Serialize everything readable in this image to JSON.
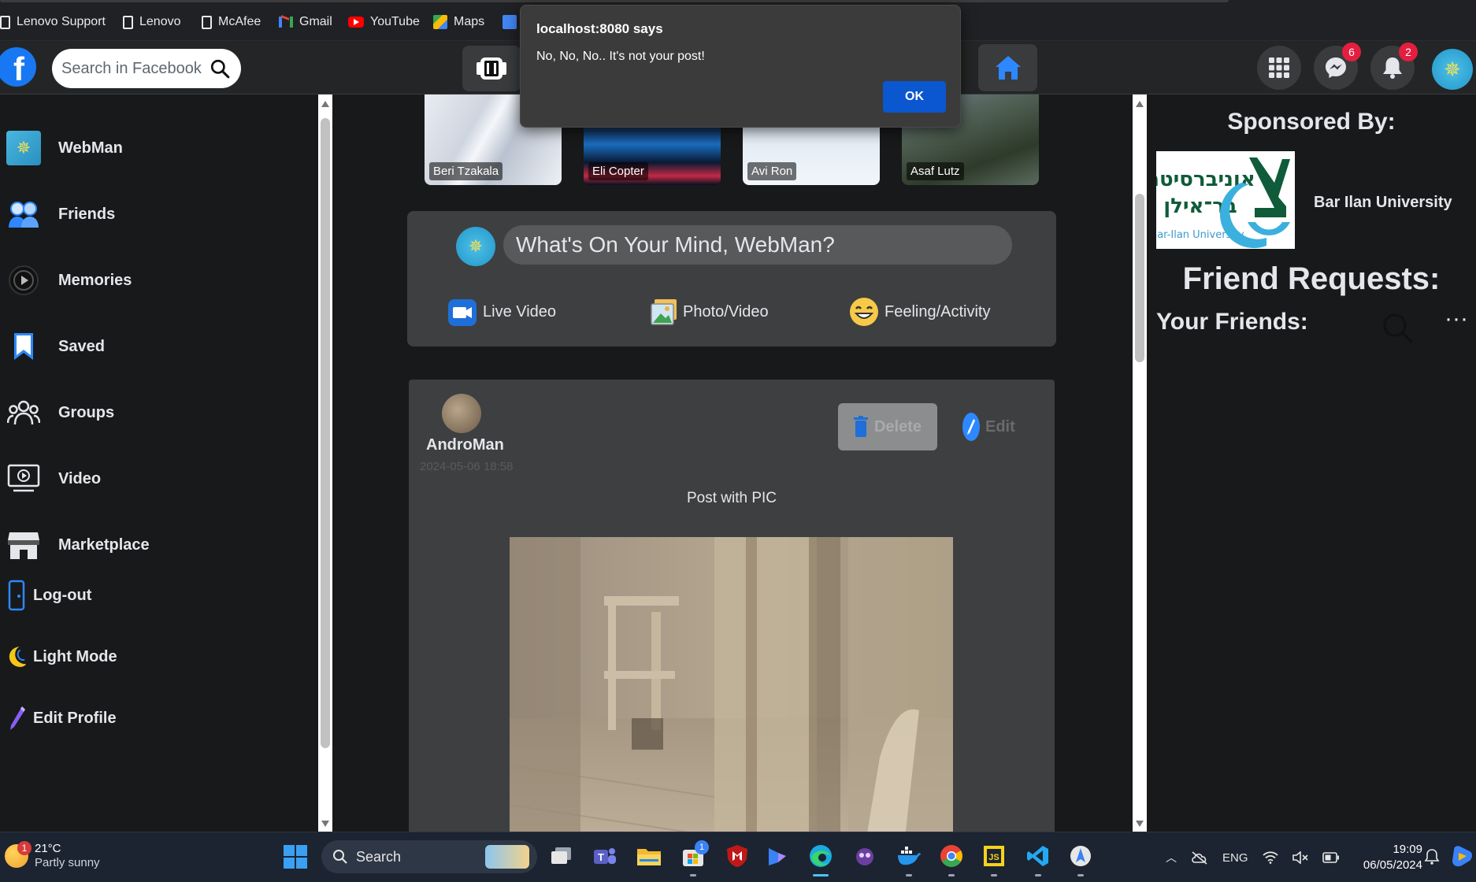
{
  "bookmarks": [
    {
      "label": "Lenovo Support",
      "icon": "document-icon"
    },
    {
      "label": "Lenovo",
      "icon": "document-icon"
    },
    {
      "label": "McAfee",
      "icon": "document-icon"
    },
    {
      "label": "Gmail",
      "icon": "gmail-icon"
    },
    {
      "label": "YouTube",
      "icon": "youtube-icon"
    },
    {
      "label": "Maps",
      "icon": "maps-icon"
    }
  ],
  "header": {
    "search_placeholder": "Search in Facebook",
    "messenger_badge": "6",
    "notifications_badge": "2",
    "brand_color": "#1877f2"
  },
  "sidebar": {
    "items": [
      {
        "label": "WebMan",
        "icon": "profile-avatar-icon"
      },
      {
        "label": "Friends",
        "icon": "friends-icon"
      },
      {
        "label": "Memories",
        "icon": "memories-icon"
      },
      {
        "label": "Saved",
        "icon": "bookmark-icon"
      },
      {
        "label": "Groups",
        "icon": "groups-icon"
      },
      {
        "label": "Video",
        "icon": "video-icon"
      },
      {
        "label": "Marketplace",
        "icon": "marketplace-icon"
      }
    ],
    "actions": [
      {
        "label": "Log-out",
        "icon": "logout-icon"
      },
      {
        "label": "Light Mode",
        "icon": "moon-icon"
      },
      {
        "label": "Edit Profile",
        "icon": "pencil-icon"
      }
    ]
  },
  "stories": [
    {
      "name": "Beri Tzakala"
    },
    {
      "name": "Eli Copter"
    },
    {
      "name": "Avi Ron"
    },
    {
      "name": "Asaf Lutz"
    }
  ],
  "composer": {
    "prompt": "What's On Your Mind, WebMan?",
    "actions": [
      {
        "label": "Live Video",
        "icon": "live-video-icon"
      },
      {
        "label": "Photo/Video",
        "icon": "photo-icon"
      },
      {
        "label": "Feeling/Activity",
        "icon": "smiley-icon"
      }
    ]
  },
  "post": {
    "author": "AndroMan",
    "date": "2024-05-06 18:58",
    "delete_label": "Delete",
    "edit_label": "Edit",
    "text": "Post with PIC"
  },
  "rightcol": {
    "sponsored_title": "Sponsored By:",
    "sponsor_name": "Bar Ilan University",
    "sponsor_logo_text_he_1": "אוניברסיטת",
    "sponsor_logo_text_he_2": "בר־אילן",
    "sponsor_logo_text_en": "Bar-Ilan University",
    "friend_requests_title": "Friend Requests:",
    "your_friends_title": "Your Friends:",
    "more_label": "···"
  },
  "alert": {
    "title": "localhost:8080 says",
    "message": "No, No, No.. It's not your post!",
    "ok_label": "OK"
  },
  "taskbar": {
    "weather_temp": "21°C",
    "weather_condition": "Partly sunny",
    "weather_badge": "1",
    "search_label": "Search",
    "store_badge": "1",
    "language": "ENG",
    "time": "19:09",
    "date": "06/05/2024"
  }
}
